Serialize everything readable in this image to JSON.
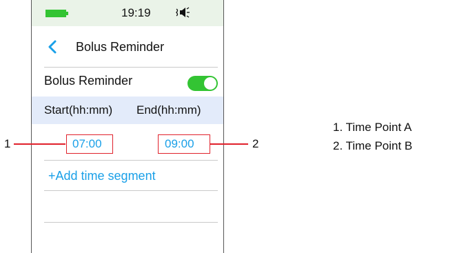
{
  "status_bar": {
    "time": "19:19",
    "battery_color": "#33c433",
    "sound_icon": "speaker-icon"
  },
  "header": {
    "back_icon": "back-chevron-icon",
    "title": "Bolus Reminder"
  },
  "reminder_row": {
    "label": "Bolus Reminder",
    "toggle_on": true,
    "toggle_color": "#33c433"
  },
  "columns": {
    "start": "Start(hh:mm)",
    "end": "End(hh:mm)"
  },
  "segment": {
    "start_time": "07:00",
    "end_time": "09:00"
  },
  "add_segment_label": "+Add time segment",
  "callouts": [
    {
      "number": "1",
      "text": "1. Time Point A"
    },
    {
      "number": "2",
      "text": "2. Time Point B"
    }
  ],
  "colors": {
    "accent": "#1aa0e8",
    "callout": "#e0202a",
    "header_band": "#e3ebfa"
  }
}
